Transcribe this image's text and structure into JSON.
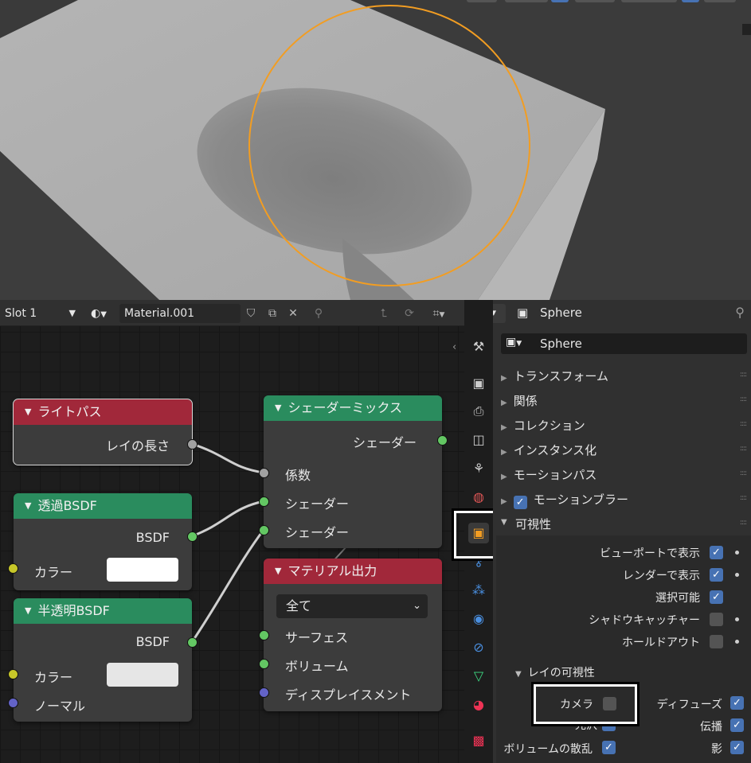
{
  "node_editor": {
    "header": {
      "slot": "Slot 1",
      "material": "Material.001",
      "icons": [
        "shield-icon",
        "copy-icon",
        "close-icon",
        "pin-icon",
        "parent-icon",
        "slot-link-icon",
        "snap-icon"
      ]
    },
    "nodes": {
      "light_path": {
        "title": "ライトパス",
        "output": "レイの長さ"
      },
      "transparent": {
        "title": "透過BSDF",
        "output": "BSDF",
        "color_label": "カラー",
        "color": "#ffffff"
      },
      "translucent": {
        "title": "半透明BSDF",
        "output": "BSDF",
        "color_label": "カラー",
        "normal_label": "ノーマル",
        "color": "#e6e6e6"
      },
      "mix_shader": {
        "title": "シェーダーミックス",
        "output": "シェーダー",
        "fac": "係数",
        "shader1": "シェーダー",
        "shader2": "シェーダー"
      },
      "material_output": {
        "title": "マテリアル出力",
        "target": "全て",
        "surface": "サーフェス",
        "volume": "ボリューム",
        "displacement": "ディスプレイスメント"
      }
    }
  },
  "properties": {
    "header_object": "Sphere",
    "object_name": "Sphere",
    "sections": [
      "トランスフォーム",
      "関係",
      "コレクション",
      "インスタンス化",
      "モーションパス"
    ],
    "motion_blur": {
      "label": "モーションブラー",
      "checked": true
    },
    "visibility": {
      "title": "可視性",
      "viewport": {
        "label": "ビューポートで表示",
        "checked": true
      },
      "render": {
        "label": "レンダーで表示",
        "checked": true
      },
      "selectable": {
        "label": "選択可能",
        "checked": true
      },
      "shadow_catcher": {
        "label": "シャドウキャッチャー",
        "checked": false
      },
      "holdout": {
        "label": "ホールドアウト",
        "checked": false
      }
    },
    "ray_visibility": {
      "title": "レイの可視性",
      "camera": {
        "label": "カメラ",
        "checked": false
      },
      "diffuse": {
        "label": "ディフューズ",
        "checked": true
      },
      "glossy": {
        "label": "光沢",
        "checked": true
      },
      "transmission": {
        "label": "伝播",
        "checked": true
      },
      "volume_scatter": {
        "label": "ボリュームの散乱",
        "checked": true
      },
      "shadow": {
        "label": "影",
        "checked": true
      }
    }
  },
  "colors": {
    "accent": "#4772b3",
    "selection": "#f29d22",
    "node_header_red": "#a1283a",
    "node_header_green": "#2a8c5e"
  }
}
